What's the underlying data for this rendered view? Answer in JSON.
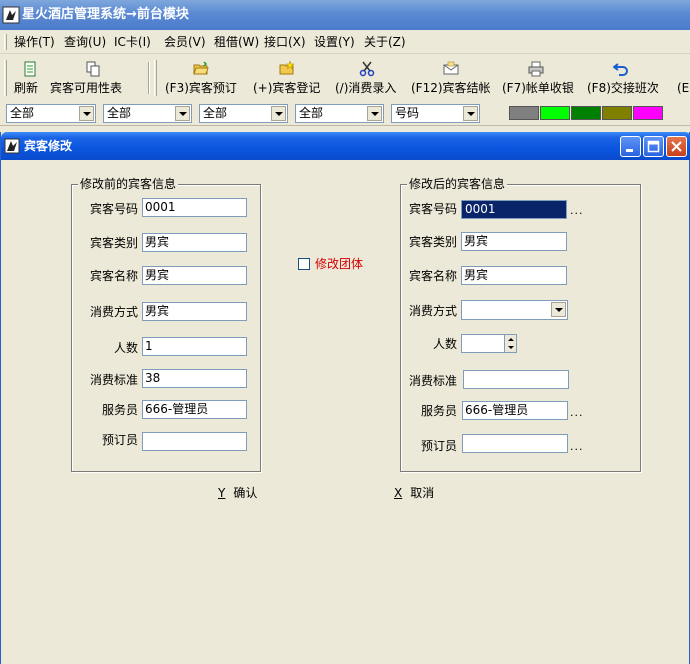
{
  "app": {
    "title": "星火酒店管理系统→前台模块"
  },
  "menu": [
    {
      "label": "操作(T)"
    },
    {
      "label": "查询(U)"
    },
    {
      "label": "IC卡(I)"
    },
    {
      "label": "会员(V)"
    },
    {
      "label": "租借(W)"
    },
    {
      "label": "接口(X)"
    },
    {
      "label": "设置(Y)"
    },
    {
      "label": "关于(Z)"
    }
  ],
  "toolbar": [
    {
      "label": "刷新",
      "icon": "refresh-icon"
    },
    {
      "label": "宾客可用性表",
      "icon": "copy-icon"
    },
    {
      "label": "(F3)宾客预订",
      "icon": "folder-open-icon"
    },
    {
      "label": "(+)宾客登记",
      "icon": "folder-new-icon"
    },
    {
      "label": "(/)消费录入",
      "icon": "scissors-icon"
    },
    {
      "label": "(F12)宾客结帐",
      "icon": "envelope-icon"
    },
    {
      "label": "(F7)帐单收银",
      "icon": "printer-icon"
    },
    {
      "label": "(F8)交接班次",
      "icon": "undo-icon"
    },
    {
      "label": "(E",
      "icon": ""
    }
  ],
  "filters": [
    {
      "value": "全部"
    },
    {
      "value": "全部"
    },
    {
      "value": "全部"
    },
    {
      "value": "全部"
    },
    {
      "value": "号码"
    }
  ],
  "swatches": [
    "#808080",
    "#00ff00",
    "#008000",
    "#808000",
    "#ff00ff"
  ],
  "dialog": {
    "title": "宾客修改",
    "before": {
      "legend": "修改前的宾客信息",
      "fields": [
        {
          "label": "宾客号码",
          "value": "0001"
        },
        {
          "label": "宾客类别",
          "value": "男宾"
        },
        {
          "label": "宾客名称",
          "value": "男宾"
        },
        {
          "label": "消费方式",
          "value": "男宾"
        },
        {
          "label": "人数",
          "value": "1"
        },
        {
          "label": "消费标准",
          "value": "38"
        },
        {
          "label": "服务员",
          "value": "666-管理员"
        },
        {
          "label": "预订员",
          "value": ""
        }
      ]
    },
    "group_checkbox": {
      "label": "修改团体",
      "checked": false
    },
    "after": {
      "legend": "修改后的宾客信息",
      "fields": [
        {
          "label": "宾客号码",
          "value": "0001"
        },
        {
          "label": "宾客类别",
          "value": "男宾"
        },
        {
          "label": "宾客名称",
          "value": "男宾"
        },
        {
          "label": "消费方式",
          "value": ""
        },
        {
          "label": "人数",
          "value": ""
        },
        {
          "label": "消费标准",
          "value": ""
        },
        {
          "label": "服务员",
          "value": "666-管理员"
        },
        {
          "label": "预订员",
          "value": ""
        }
      ],
      "dots": "..."
    },
    "confirm": {
      "key": "Y",
      "label": "确认"
    },
    "cancel": {
      "key": "X",
      "label": "取消"
    }
  }
}
